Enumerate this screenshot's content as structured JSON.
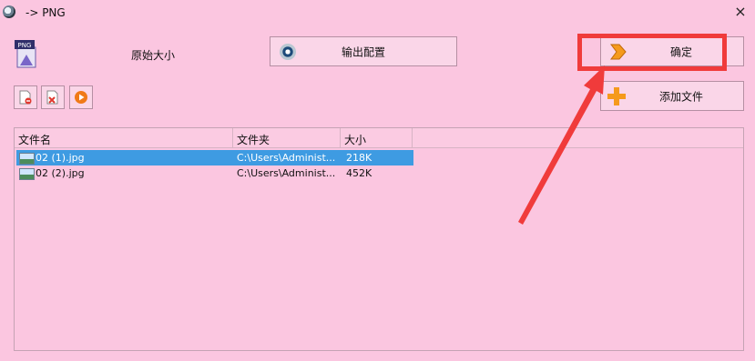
{
  "window": {
    "title": "-> PNG",
    "close_label": "×"
  },
  "format_badge": "PNG",
  "original_size_label": "原始大小",
  "buttons": {
    "output_settings": "输出配置",
    "confirm": "确定",
    "add_file": "添加文件"
  },
  "list": {
    "columns": [
      "文件名",
      "文件夹",
      "大小"
    ],
    "rows": [
      {
        "name": "02 (1).jpg",
        "folder": "C:\\Users\\Administ...",
        "size": "218K",
        "selected": true
      },
      {
        "name": "02 (2).jpg",
        "folder": "C:\\Users\\Administ...",
        "size": "452K",
        "selected": false
      }
    ]
  },
  "colors": {
    "background": "#fbc6e0",
    "selection": "#3e9be2",
    "annotation": "#f03b3b",
    "accent_orange": "#f59a1c"
  }
}
